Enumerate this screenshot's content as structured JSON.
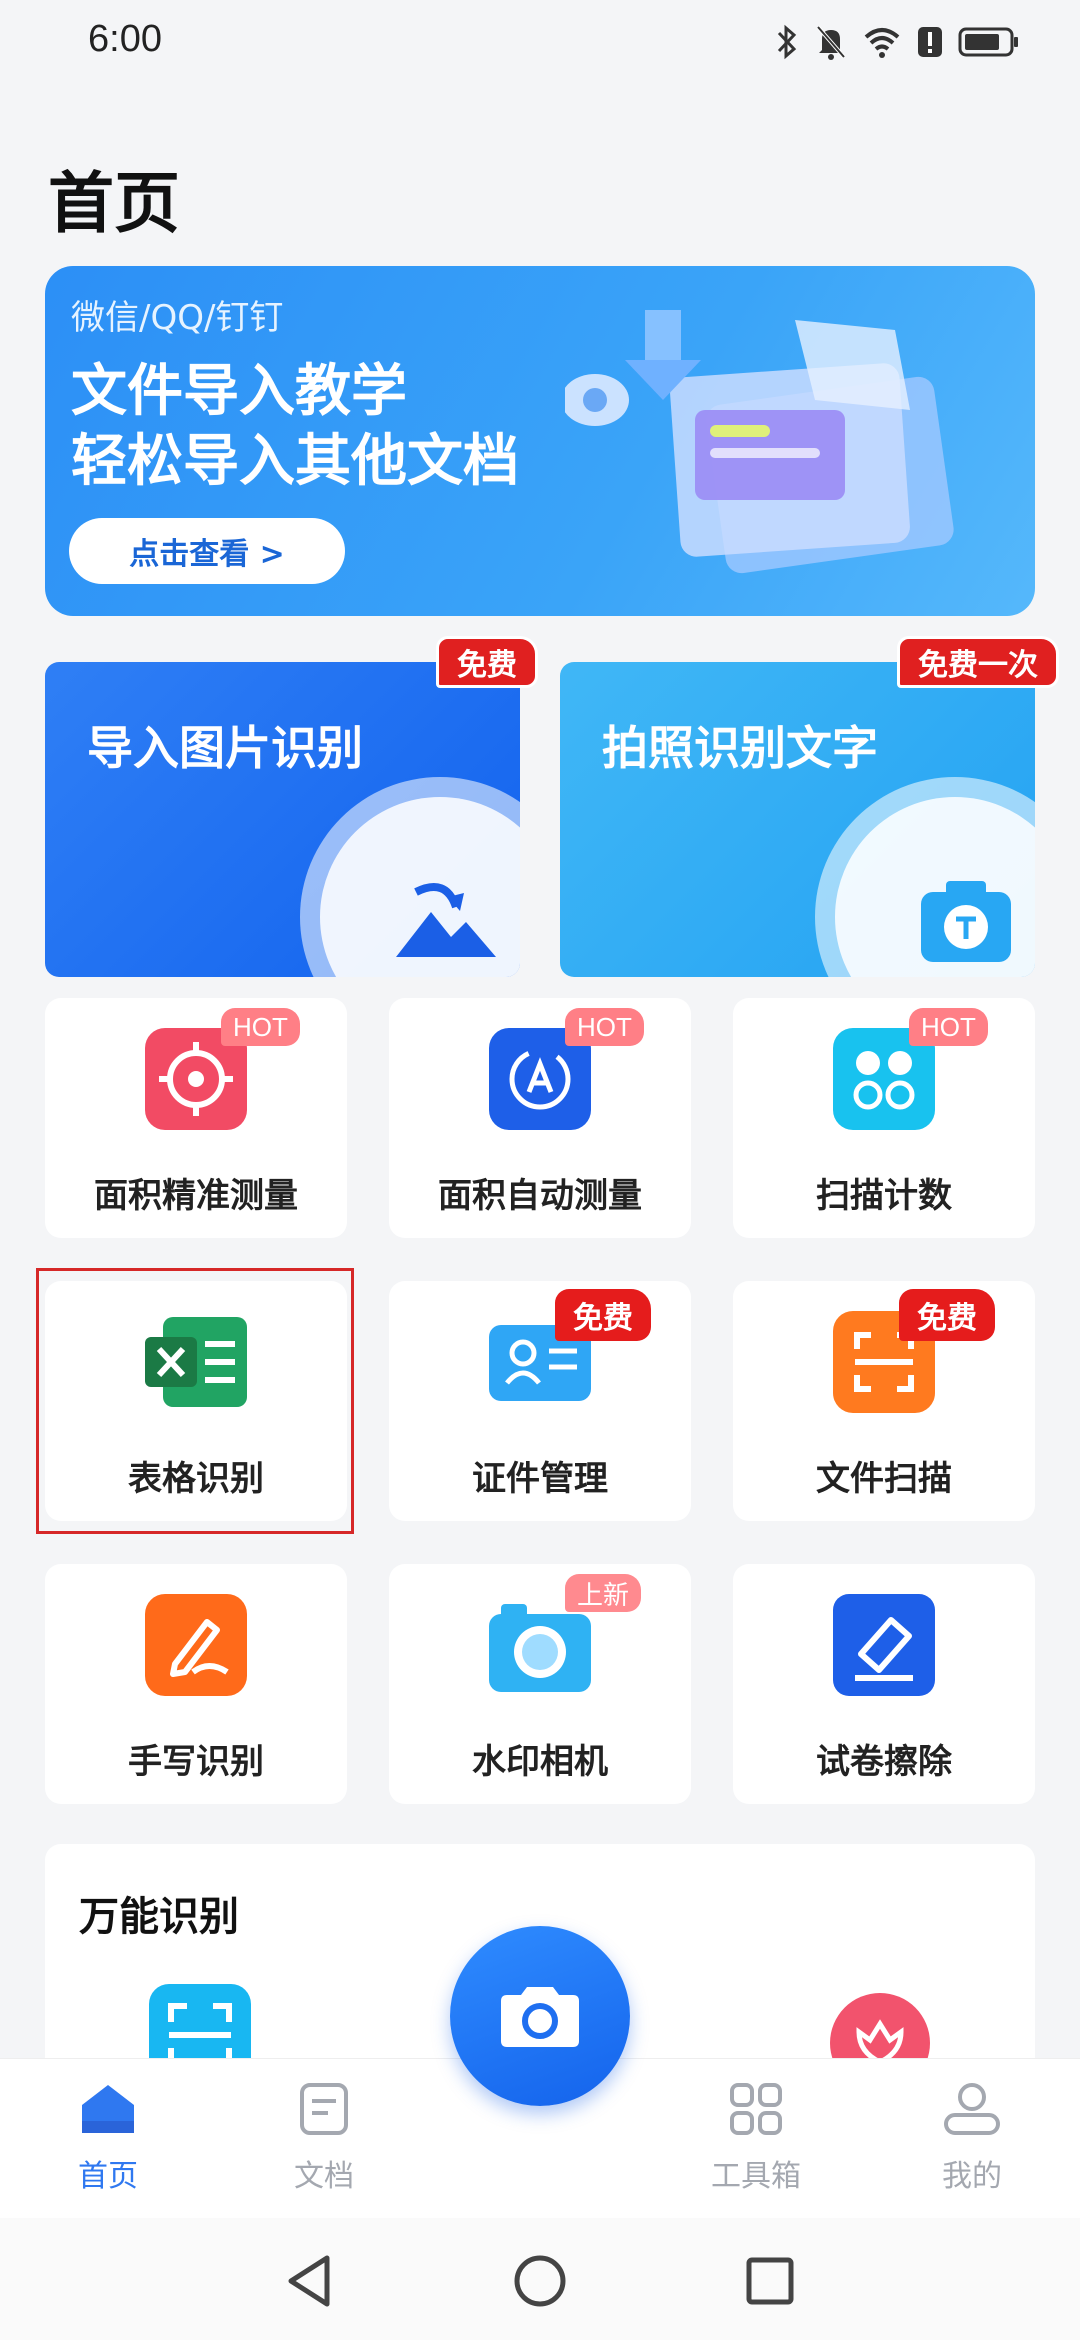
{
  "status_bar": {
    "time": "6:00"
  },
  "header": {
    "title": "首页"
  },
  "banner": {
    "subtitle": "微信/QQ/钉钉",
    "line1": "文件导入教学",
    "line2": "轻松导入其他文档",
    "button": "点击查看 >"
  },
  "big_cards": [
    {
      "label": "导入图片识别",
      "tag": "免费"
    },
    {
      "label": "拍照识别文字",
      "tag": "免费一次"
    }
  ],
  "tools": [
    {
      "label": "面积精准测量",
      "tag": "HOT",
      "color": "#f24b64"
    },
    {
      "label": "面积自动测量",
      "tag": "HOT",
      "color": "#1e5fe8"
    },
    {
      "label": "扫描计数",
      "tag": "HOT",
      "color": "#18c2ef"
    },
    {
      "label": "表格识别",
      "tag": "",
      "color": "#21a463"
    },
    {
      "label": "证件管理",
      "tag": "免费",
      "color": "#2fa6f5"
    },
    {
      "label": "文件扫描",
      "tag": "免费",
      "color": "#ff7a1f"
    },
    {
      "label": "手写识别",
      "tag": "",
      "color": "#ff6a1a"
    },
    {
      "label": "水印相机",
      "tag": "上新",
      "color": "#2fb2f3"
    },
    {
      "label": "试卷擦除",
      "tag": "",
      "color": "#1e5fe8"
    }
  ],
  "section": {
    "title": "万能识别"
  },
  "bottom_nav": [
    {
      "label": "首页",
      "icon": "home-icon"
    },
    {
      "label": "文档",
      "icon": "document-icon"
    },
    {
      "label": "工具箱",
      "icon": "toolbox-icon"
    },
    {
      "label": "我的",
      "icon": "profile-icon"
    }
  ],
  "colors": {
    "accent": "#2f78f0",
    "hot": "#ff7f86",
    "free": "#e51c1c"
  }
}
